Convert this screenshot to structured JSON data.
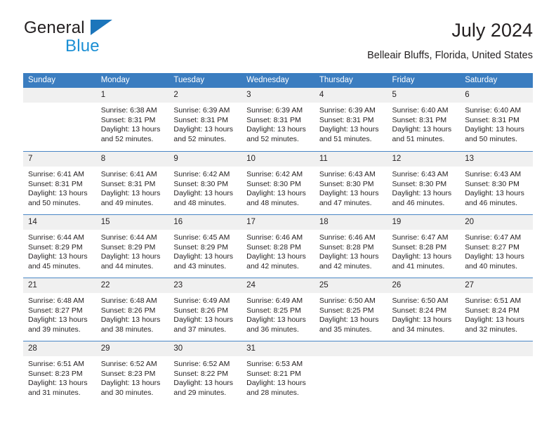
{
  "brand": {
    "name_top": "General",
    "name_bottom": "Blue",
    "accent_color": "#1b75bb",
    "accent_color_light": "#1b8fd4"
  },
  "header": {
    "title": "July 2024",
    "subtitle": "Belleair Bluffs, Florida, United States"
  },
  "colors": {
    "header_row_background": "#3b7dc0",
    "daynum_background": "#f0f0f0",
    "grid_line": "#4a86c5",
    "text": "#231f20"
  },
  "weekday_headers": [
    "Sunday",
    "Monday",
    "Tuesday",
    "Wednesday",
    "Thursday",
    "Friday",
    "Saturday"
  ],
  "labels": {
    "sunrise_prefix": "Sunrise: ",
    "sunset_prefix": "Sunset: ",
    "daylight_prefix": "Daylight: "
  },
  "weeks": [
    [
      {
        "day": "",
        "blank": true
      },
      {
        "day": "1",
        "sunrise": "Sunrise: 6:38 AM",
        "sunset": "Sunset: 8:31 PM",
        "daylight_1": "Daylight: 13 hours",
        "daylight_2": "and 52 minutes."
      },
      {
        "day": "2",
        "sunrise": "Sunrise: 6:39 AM",
        "sunset": "Sunset: 8:31 PM",
        "daylight_1": "Daylight: 13 hours",
        "daylight_2": "and 52 minutes."
      },
      {
        "day": "3",
        "sunrise": "Sunrise: 6:39 AM",
        "sunset": "Sunset: 8:31 PM",
        "daylight_1": "Daylight: 13 hours",
        "daylight_2": "and 52 minutes."
      },
      {
        "day": "4",
        "sunrise": "Sunrise: 6:39 AM",
        "sunset": "Sunset: 8:31 PM",
        "daylight_1": "Daylight: 13 hours",
        "daylight_2": "and 51 minutes."
      },
      {
        "day": "5",
        "sunrise": "Sunrise: 6:40 AM",
        "sunset": "Sunset: 8:31 PM",
        "daylight_1": "Daylight: 13 hours",
        "daylight_2": "and 51 minutes."
      },
      {
        "day": "6",
        "sunrise": "Sunrise: 6:40 AM",
        "sunset": "Sunset: 8:31 PM",
        "daylight_1": "Daylight: 13 hours",
        "daylight_2": "and 50 minutes."
      }
    ],
    [
      {
        "day": "7",
        "sunrise": "Sunrise: 6:41 AM",
        "sunset": "Sunset: 8:31 PM",
        "daylight_1": "Daylight: 13 hours",
        "daylight_2": "and 50 minutes."
      },
      {
        "day": "8",
        "sunrise": "Sunrise: 6:41 AM",
        "sunset": "Sunset: 8:31 PM",
        "daylight_1": "Daylight: 13 hours",
        "daylight_2": "and 49 minutes."
      },
      {
        "day": "9",
        "sunrise": "Sunrise: 6:42 AM",
        "sunset": "Sunset: 8:30 PM",
        "daylight_1": "Daylight: 13 hours",
        "daylight_2": "and 48 minutes."
      },
      {
        "day": "10",
        "sunrise": "Sunrise: 6:42 AM",
        "sunset": "Sunset: 8:30 PM",
        "daylight_1": "Daylight: 13 hours",
        "daylight_2": "and 48 minutes."
      },
      {
        "day": "11",
        "sunrise": "Sunrise: 6:43 AM",
        "sunset": "Sunset: 8:30 PM",
        "daylight_1": "Daylight: 13 hours",
        "daylight_2": "and 47 minutes."
      },
      {
        "day": "12",
        "sunrise": "Sunrise: 6:43 AM",
        "sunset": "Sunset: 8:30 PM",
        "daylight_1": "Daylight: 13 hours",
        "daylight_2": "and 46 minutes."
      },
      {
        "day": "13",
        "sunrise": "Sunrise: 6:43 AM",
        "sunset": "Sunset: 8:30 PM",
        "daylight_1": "Daylight: 13 hours",
        "daylight_2": "and 46 minutes."
      }
    ],
    [
      {
        "day": "14",
        "sunrise": "Sunrise: 6:44 AM",
        "sunset": "Sunset: 8:29 PM",
        "daylight_1": "Daylight: 13 hours",
        "daylight_2": "and 45 minutes."
      },
      {
        "day": "15",
        "sunrise": "Sunrise: 6:44 AM",
        "sunset": "Sunset: 8:29 PM",
        "daylight_1": "Daylight: 13 hours",
        "daylight_2": "and 44 minutes."
      },
      {
        "day": "16",
        "sunrise": "Sunrise: 6:45 AM",
        "sunset": "Sunset: 8:29 PM",
        "daylight_1": "Daylight: 13 hours",
        "daylight_2": "and 43 minutes."
      },
      {
        "day": "17",
        "sunrise": "Sunrise: 6:46 AM",
        "sunset": "Sunset: 8:28 PM",
        "daylight_1": "Daylight: 13 hours",
        "daylight_2": "and 42 minutes."
      },
      {
        "day": "18",
        "sunrise": "Sunrise: 6:46 AM",
        "sunset": "Sunset: 8:28 PM",
        "daylight_1": "Daylight: 13 hours",
        "daylight_2": "and 42 minutes."
      },
      {
        "day": "19",
        "sunrise": "Sunrise: 6:47 AM",
        "sunset": "Sunset: 8:28 PM",
        "daylight_1": "Daylight: 13 hours",
        "daylight_2": "and 41 minutes."
      },
      {
        "day": "20",
        "sunrise": "Sunrise: 6:47 AM",
        "sunset": "Sunset: 8:27 PM",
        "daylight_1": "Daylight: 13 hours",
        "daylight_2": "and 40 minutes."
      }
    ],
    [
      {
        "day": "21",
        "sunrise": "Sunrise: 6:48 AM",
        "sunset": "Sunset: 8:27 PM",
        "daylight_1": "Daylight: 13 hours",
        "daylight_2": "and 39 minutes."
      },
      {
        "day": "22",
        "sunrise": "Sunrise: 6:48 AM",
        "sunset": "Sunset: 8:26 PM",
        "daylight_1": "Daylight: 13 hours",
        "daylight_2": "and 38 minutes."
      },
      {
        "day": "23",
        "sunrise": "Sunrise: 6:49 AM",
        "sunset": "Sunset: 8:26 PM",
        "daylight_1": "Daylight: 13 hours",
        "daylight_2": "and 37 minutes."
      },
      {
        "day": "24",
        "sunrise": "Sunrise: 6:49 AM",
        "sunset": "Sunset: 8:25 PM",
        "daylight_1": "Daylight: 13 hours",
        "daylight_2": "and 36 minutes."
      },
      {
        "day": "25",
        "sunrise": "Sunrise: 6:50 AM",
        "sunset": "Sunset: 8:25 PM",
        "daylight_1": "Daylight: 13 hours",
        "daylight_2": "and 35 minutes."
      },
      {
        "day": "26",
        "sunrise": "Sunrise: 6:50 AM",
        "sunset": "Sunset: 8:24 PM",
        "daylight_1": "Daylight: 13 hours",
        "daylight_2": "and 34 minutes."
      },
      {
        "day": "27",
        "sunrise": "Sunrise: 6:51 AM",
        "sunset": "Sunset: 8:24 PM",
        "daylight_1": "Daylight: 13 hours",
        "daylight_2": "and 32 minutes."
      }
    ],
    [
      {
        "day": "28",
        "sunrise": "Sunrise: 6:51 AM",
        "sunset": "Sunset: 8:23 PM",
        "daylight_1": "Daylight: 13 hours",
        "daylight_2": "and 31 minutes."
      },
      {
        "day": "29",
        "sunrise": "Sunrise: 6:52 AM",
        "sunset": "Sunset: 8:23 PM",
        "daylight_1": "Daylight: 13 hours",
        "daylight_2": "and 30 minutes."
      },
      {
        "day": "30",
        "sunrise": "Sunrise: 6:52 AM",
        "sunset": "Sunset: 8:22 PM",
        "daylight_1": "Daylight: 13 hours",
        "daylight_2": "and 29 minutes."
      },
      {
        "day": "31",
        "sunrise": "Sunrise: 6:53 AM",
        "sunset": "Sunset: 8:21 PM",
        "daylight_1": "Daylight: 13 hours",
        "daylight_2": "and 28 minutes."
      },
      {
        "day": "",
        "blank": true
      },
      {
        "day": "",
        "blank": true
      },
      {
        "day": "",
        "blank": true
      }
    ]
  ]
}
